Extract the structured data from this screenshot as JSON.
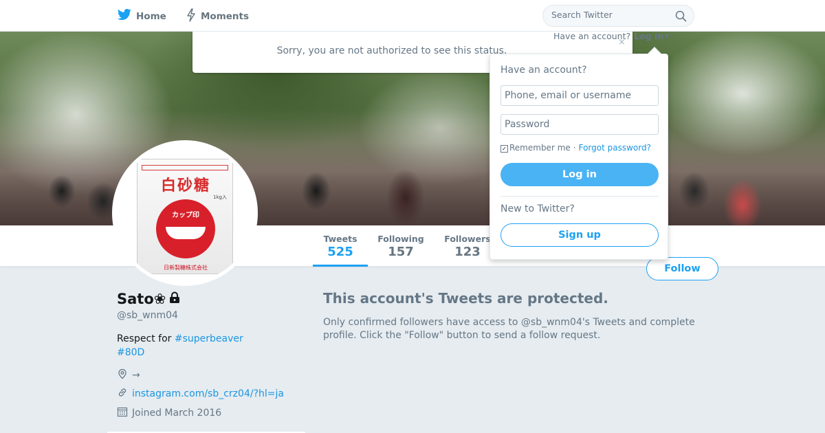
{
  "nav": {
    "home_label": "Home",
    "moments_label": "Moments",
    "search_placeholder": "Search Twitter"
  },
  "status_banner": {
    "message": "Sorry, you are not authorized to see this status.",
    "close": "×"
  },
  "login_strip": {
    "prompt": "Have an account?",
    "login_label": "Log in"
  },
  "login_dropdown": {
    "heading": "Have an account?",
    "username_placeholder": "Phone, email or username",
    "password_placeholder": "Password",
    "remember_label": "Remember me",
    "separator": "·",
    "forgot_label": "Forgot password?",
    "login_button": "Log in",
    "new_prompt": "New to Twitter?",
    "signup_button": "Sign up"
  },
  "stats": [
    {
      "label": "Tweets",
      "value": "525"
    },
    {
      "label": "Following",
      "value": "157"
    },
    {
      "label": "Followers",
      "value": "123"
    }
  ],
  "follow_button": "Follow",
  "avatar": {
    "product_name": "白砂糖",
    "brand": "カップ印",
    "weight": "1kg入",
    "maker": "日新製糖株式会社"
  },
  "profile": {
    "name": "Sato❀",
    "handle": "@sb_wnm04",
    "bio_text": "Respect for ",
    "bio_hashtag_1": "#superbeaver",
    "bio_hashtag_2": "#80D",
    "location": "→",
    "url": "instagram.com/sb_crz04/?hl=ja",
    "joined": "Joined March 2016"
  },
  "protected": {
    "title": "This account's Tweets are protected.",
    "description": "Only confirmed followers have access to @sb_wnm04's Tweets and complete profile. Click the \"Follow\" button to send a follow request."
  },
  "colors": {
    "accent": "#1da1f2",
    "login_button_bg": "#4ab3f4",
    "page_bg": "#e6ecf0",
    "muted_text": "#657786"
  }
}
